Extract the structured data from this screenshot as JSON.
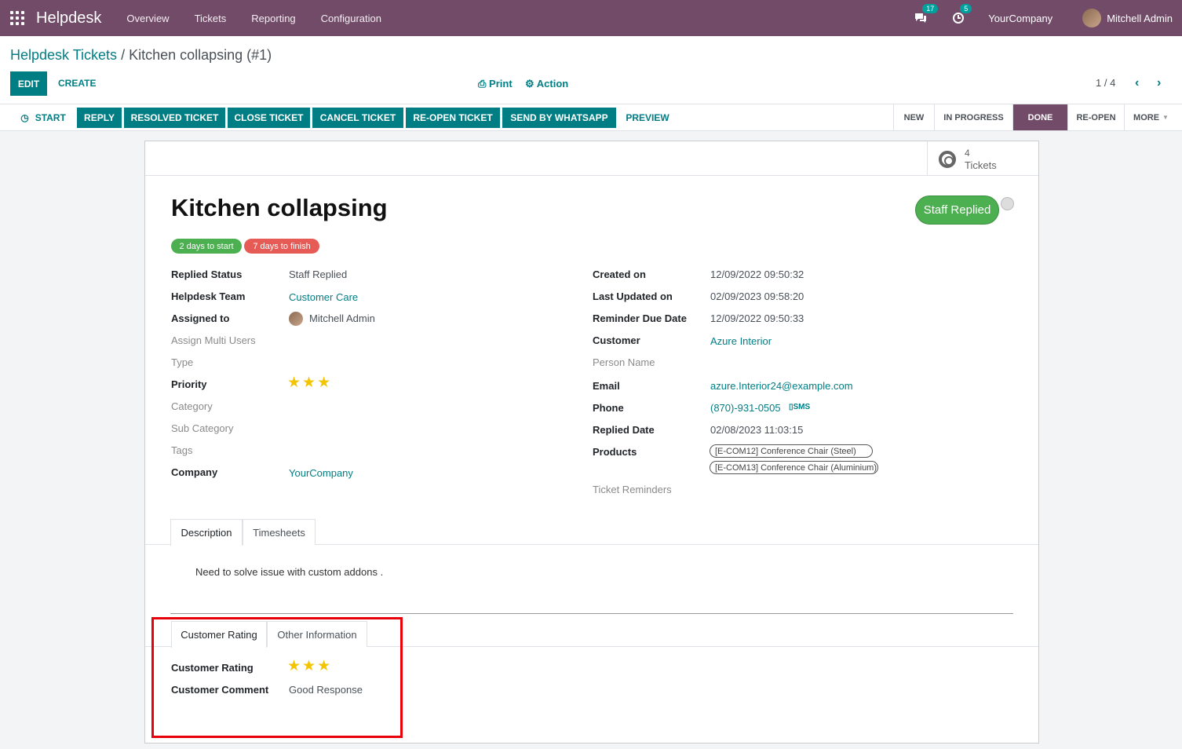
{
  "navbar": {
    "brand": "Helpdesk",
    "menu": [
      "Overview",
      "Tickets",
      "Reporting",
      "Configuration"
    ],
    "messages_count": "17",
    "activities_count": "5",
    "company": "YourCompany",
    "user": "Mitchell Admin"
  },
  "control": {
    "breadcrumb_parent": "Helpdesk Tickets",
    "breadcrumb_sep": " / ",
    "breadcrumb_current": "Kitchen collapsing (#1)",
    "edit": "EDIT",
    "create": "CREATE",
    "print": "Print",
    "action": "Action",
    "pager": "1 / 4"
  },
  "statusbar": {
    "start": "START",
    "buttons": [
      "REPLY",
      "RESOLVED TICKET",
      "CLOSE TICKET",
      "CANCEL TICKET",
      "RE-OPEN TICKET",
      "SEND BY WHATSAPP"
    ],
    "preview": "PREVIEW",
    "stages": [
      "NEW",
      "IN PROGRESS",
      "DONE",
      "RE-OPEN",
      "MORE"
    ],
    "active_stage": "DONE"
  },
  "ticket": {
    "tickets_count": "4",
    "tickets_label": "Tickets",
    "title": "Kitchen collapsing",
    "ribbon": "Staff Replied",
    "tags": [
      "2 days to start",
      "7 days to finish"
    ],
    "tag_colors": [
      "#4caf50",
      "#e65b55"
    ],
    "left_fields": [
      {
        "label": "Replied Status",
        "value": "Staff Replied"
      },
      {
        "label": "Helpdesk Team",
        "value": "Customer Care"
      },
      {
        "label": "Assigned to",
        "value": "Mitchell Admin"
      },
      {
        "label": "Assign Multi Users",
        "value": ""
      },
      {
        "label": "Type",
        "value": ""
      },
      {
        "label": "Priority",
        "value": "",
        "stars": 3
      },
      {
        "label": "Category",
        "value": ""
      },
      {
        "label": "Sub Category",
        "value": ""
      },
      {
        "label": "Tags",
        "value": ""
      },
      {
        "label": "Company",
        "value": "YourCompany"
      }
    ],
    "right_fields": [
      {
        "label": "Created on",
        "value": "12/09/2022 09:50:32"
      },
      {
        "label": "Last Updated on",
        "value": "02/09/2023 09:58:20"
      },
      {
        "label": "Reminder Due Date",
        "value": "12/09/2022 09:50:33"
      },
      {
        "label": "Customer",
        "value": "Azure Interior"
      },
      {
        "label": "Person Name",
        "value": ""
      },
      {
        "label": "Email",
        "value": "azure.Interior24@example.com"
      },
      {
        "label": "Phone",
        "value": "(870)-931-0505"
      },
      {
        "label": "Replied Date",
        "value": "02/08/2023 11:03:15"
      },
      {
        "label": "Products",
        "value": ""
      },
      {
        "label": "Ticket Reminders",
        "value": ""
      }
    ],
    "sms": "SMS",
    "products": [
      "[E-COM12] Conference Chair (Steel)",
      "[E-COM13] Conference Chair (Aluminium)"
    ],
    "tabs1": [
      "Description",
      "Timesheets"
    ],
    "description": "Need to solve issue with custom addons .",
    "tabs2": [
      "Customer Rating",
      "Other Information"
    ],
    "rating_label": "Customer Rating",
    "rating_stars": 3,
    "comment_label": "Customer Comment",
    "comment_value": "Good Response"
  },
  "colors": {
    "brand": "#714b67",
    "accent": "#017e84",
    "highlight": "#e8000b"
  }
}
